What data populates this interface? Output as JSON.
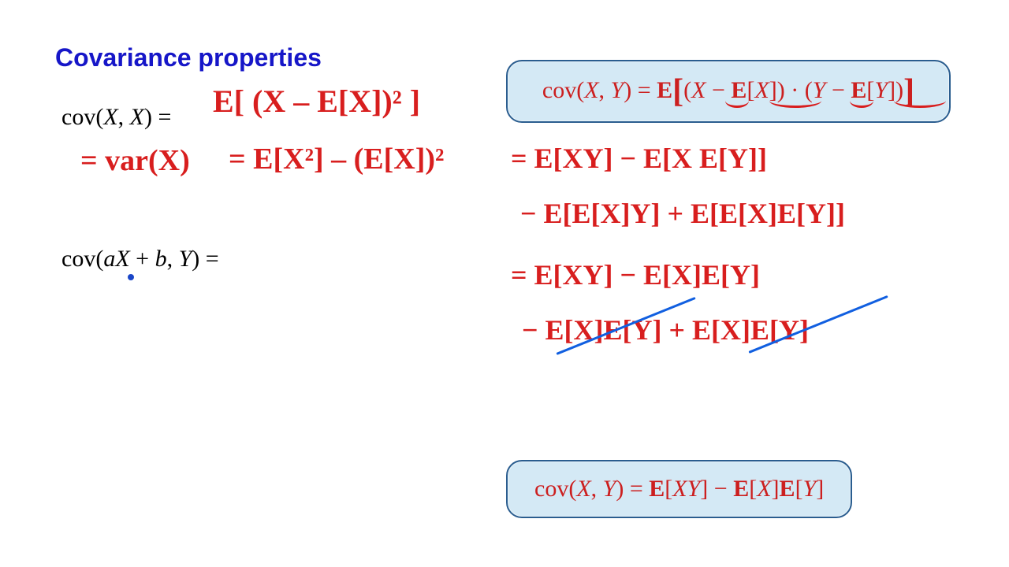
{
  "title": "Covariance properties",
  "left": {
    "line1_typeset": "cov(X, X) =",
    "line1_hand": "E[ (X – E[X])² ]",
    "line2_hand_a": "= var(X)",
    "line2_hand_b": "= E[X²] – (E[X])²",
    "line3_typeset": "cov(aX + b, Y) ="
  },
  "box_top": {
    "text_prefix": "cov(",
    "X": "X",
    "comma": ", ",
    "Y": "Y",
    "eq": ") = ",
    "E": "E",
    "open": "[",
    "lpar": "(",
    "Xm": "X",
    "minus": " − ",
    "E1": "E",
    "brX": "[X]",
    "rpar": ")",
    "dot": " · ",
    "lpar2": "(",
    "Ym": "Y",
    "minus2": " − ",
    "E2": "E",
    "brY": "[Y]",
    "rpar2": ")",
    "close": "]"
  },
  "derivation": {
    "l1": "= E[XY] − E[X E[Y]]",
    "l2": "− E[E[X]Y] + E[E[X]E[Y]]",
    "l3": "= E[XY] − E[X]E[Y]",
    "l4": "− E[X]E[Y] + E[X]E[Y]"
  },
  "box_bottom": {
    "full": "cov(X, Y) = E[XY] − E[X]E[Y]"
  }
}
